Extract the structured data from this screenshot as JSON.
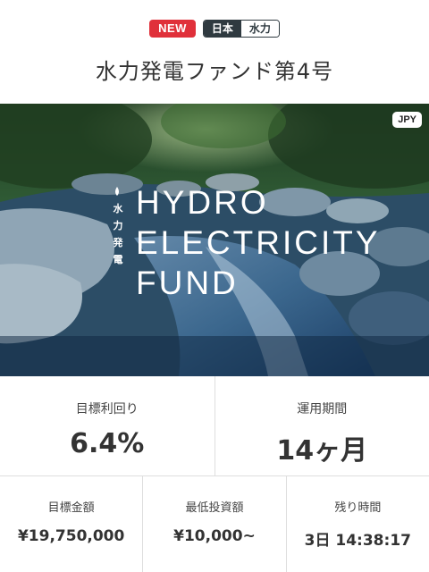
{
  "tags": {
    "new": "NEW",
    "country": "日本",
    "category": "水力"
  },
  "title": "水力発電ファンド第4号",
  "hero": {
    "currency_badge": "JPY",
    "headline_lines": [
      "HYDRO",
      "ELECTRICITY",
      "FUND"
    ],
    "vertical_text": [
      "水",
      "力",
      "発",
      "電"
    ]
  },
  "stats": {
    "target_yield": {
      "label": "目標利回り",
      "value": "6.4%"
    },
    "period": {
      "label": "運用期間",
      "value": "14ヶ月"
    },
    "target_amount": {
      "label": "目標金額",
      "value": "¥19,750,000"
    },
    "min_investment": {
      "label": "最低投資額",
      "value": "¥10,000~"
    },
    "time_left": {
      "label": "残り時間",
      "value": "3日 14:38:17"
    }
  }
}
